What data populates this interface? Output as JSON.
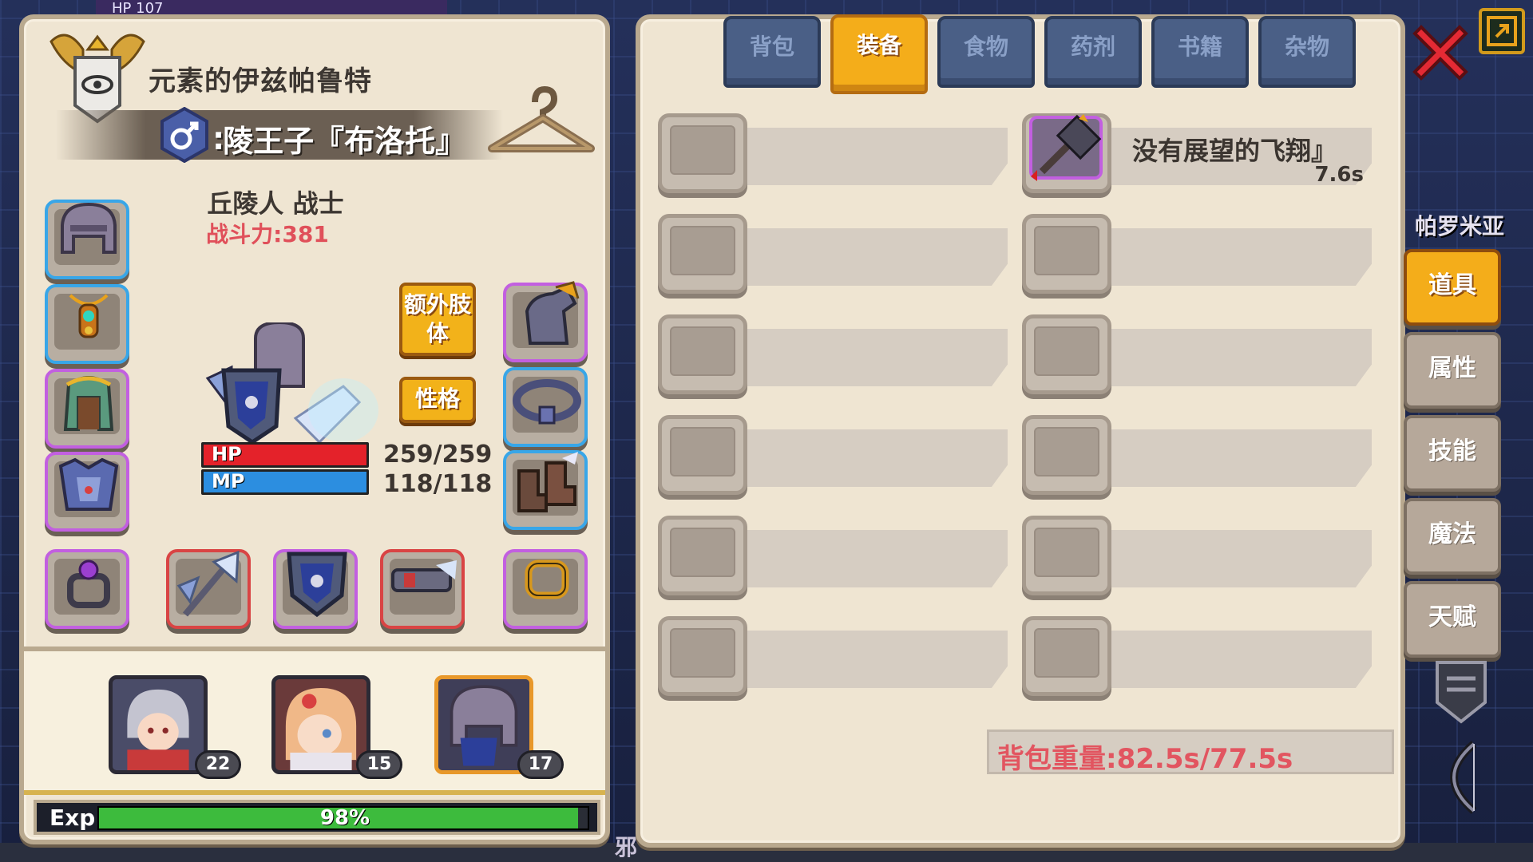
{
  "hud": {
    "top_strip": "HP 107",
    "world_label": "邪"
  },
  "character": {
    "title": "元素的伊兹帕鲁特",
    "name": "∶陵王子『布洛托』",
    "gender_symbol": "♂",
    "class": "丘陵人 战士",
    "combat_power": "战斗力:381",
    "hp_label": "HP",
    "hp": "259/259",
    "mp_label": "MP",
    "mp": "118/118",
    "hp_fraction": 1.0,
    "mp_fraction": 1.0
  },
  "buttons": {
    "extra_limb": "额外肢体",
    "personality": "性格"
  },
  "party": [
    {
      "level": "22",
      "selected": false
    },
    {
      "level": "15",
      "selected": false
    },
    {
      "level": "17",
      "selected": true
    }
  ],
  "exp": {
    "label": "Exp",
    "percent": "98%",
    "fraction": 0.98
  },
  "tabs": [
    "背包",
    "装备",
    "食物",
    "药剂",
    "书籍",
    "杂物"
  ],
  "active_tab": 1,
  "items": {
    "filled": {
      "name": "没有展望的飞翔』",
      "weight": "7.6s"
    }
  },
  "bag_weight": "背包重量:82.5s/77.5s",
  "side_menu": [
    "道具",
    "属性",
    "技能",
    "魔法",
    "天赋"
  ],
  "active_side": 0,
  "location": "帕罗米亚",
  "colors": {
    "active_tab": "#f4ad1a",
    "hp": "#e4222a",
    "mp": "#2c8ee0",
    "exp": "#3dbb3d",
    "weight_text": "#e25560",
    "combat_power": "#e0505a"
  }
}
